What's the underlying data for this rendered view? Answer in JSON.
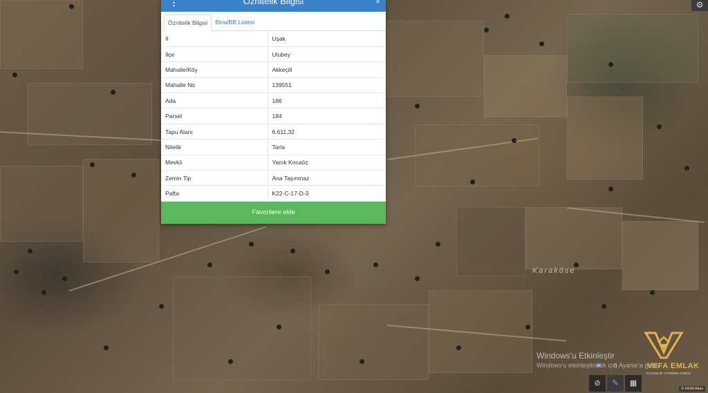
{
  "panel": {
    "title": "Öznitelik Bilgisi",
    "menu_icon": "⋮",
    "close_icon": "×",
    "tabs": [
      {
        "label": "Öznitelik Bilgisi",
        "active": true
      },
      {
        "label": "Bina/BB Listesi",
        "active": false
      }
    ],
    "rows": [
      {
        "key": "İl",
        "value": "Uşak"
      },
      {
        "key": "İlçe",
        "value": "Ulubey"
      },
      {
        "key": "Mahalle/Köy",
        "value": "Akkeçili"
      },
      {
        "key": "Mahalle No",
        "value": "139551"
      },
      {
        "key": "Ada",
        "value": "186"
      },
      {
        "key": "Parsel",
        "value": "184"
      },
      {
        "key": "Tapu Alanı",
        "value": "6.611,32"
      },
      {
        "key": "Nitelik",
        "value": "Tarla"
      },
      {
        "key": "Mevkii",
        "value": "Yanık Kocaöz"
      },
      {
        "key": "Zemin Tip",
        "value": "Ana Taşınmaz"
      },
      {
        "key": "Pafta",
        "value": "K22-C-17-D-3"
      }
    ],
    "favorite_button": "Favorilere ekle"
  },
  "map": {
    "place_label": "Karaköse",
    "attribution": "© HGM Atlas"
  },
  "watermark": {
    "activate_title": "Windows'u Etkinleştir",
    "activate_sub": "Windows'u etkinleştirmek için Ayarlar'a gidin.",
    "logo_name": "VEFA EMLAK",
    "logo_tagline": "GÜVENİLİR YATIRIMIN ADRESİ"
  },
  "colors": {
    "header_blue": "#3b81c7",
    "button_green": "#5cb85c",
    "logo_gold": "#e0b64a"
  },
  "icons": {
    "gear": "gear-icon",
    "menu": "vertical-dots-icon",
    "close": "close-icon"
  }
}
